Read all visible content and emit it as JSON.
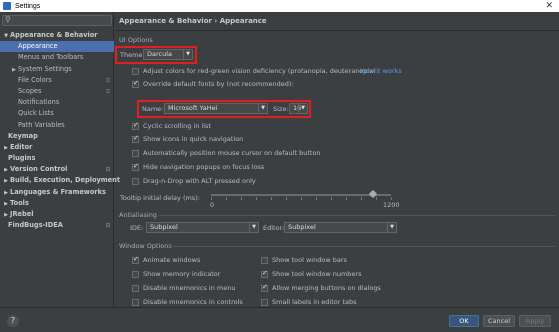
{
  "window": {
    "title": "Settings"
  },
  "search": {
    "placeholder": ""
  },
  "sidebar": {
    "items": [
      {
        "label": "Appearance & Behavior",
        "arrow": "▼",
        "bold": true
      },
      {
        "label": "Appearance",
        "selected": true
      },
      {
        "label": "Menus and Toolbars"
      },
      {
        "label": "System Settings",
        "arrow": "▶"
      },
      {
        "label": "File Colors",
        "gear": true
      },
      {
        "label": "Scopes",
        "gear": true
      },
      {
        "label": "Notifications"
      },
      {
        "label": "Quick Lists"
      },
      {
        "label": "Path Variables"
      },
      {
        "label": "Keymap",
        "bold": true
      },
      {
        "label": "Editor",
        "arrow": "▶",
        "bold": true
      },
      {
        "label": "Plugins",
        "bold": true
      },
      {
        "label": "Version Control",
        "arrow": "▶",
        "bold": true,
        "gear": true
      },
      {
        "label": "Build, Execution, Deployment",
        "arrow": "▶",
        "bold": true
      },
      {
        "label": "Languages & Frameworks",
        "arrow": "▶",
        "bold": true
      },
      {
        "label": "Tools",
        "arrow": "▶",
        "bold": true
      },
      {
        "label": "JRebel",
        "arrow": "▶",
        "bold": true
      },
      {
        "label": "FindBugs-IDEA",
        "bold": true,
        "gear": true
      }
    ]
  },
  "breadcrumb": "Appearance & Behavior › Appearance",
  "ui_options": {
    "section": "UI Options",
    "theme_label": "Theme:",
    "theme_value": "Darcula",
    "adjust_colors": "Adjust colors for red-green vision deficiency (protanopia, deuteranopia)",
    "how_it_works": "How it works",
    "override_fonts": "Override default fonts by (not recommended):",
    "name_label": "Name:",
    "name_value": "Microsoft YaHei",
    "size_label": "Size:",
    "size_value": "16",
    "cyclic": "Cyclic scrolling in list",
    "show_icons": "Show icons in quick navigation",
    "auto_mouse": "Automatically position mouse cursor on default button",
    "hide_nav": "Hide navigation popups on focus loss",
    "drag_drop": "Drag-n-Drop with ALT pressed only",
    "tooltip_label": "Tooltip initial delay (ms):",
    "tooltip_min": "0",
    "tooltip_max": "1200",
    "tooltip_value_fraction": 0.9
  },
  "antialiasing": {
    "section": "Antialiasing",
    "ide_label": "IDE:",
    "ide_value": "Subpixel",
    "editor_label": "Editor:",
    "editor_value": "Subpixel"
  },
  "window_options": {
    "section": "Window Options",
    "animate": "Animate windows",
    "memory": "Show memory indicator",
    "mnemonics_menu": "Disable mnemonics in menu",
    "mnemonics_controls": "Disable mnemonics in controls",
    "tool_bars": "Show tool window bars",
    "tool_numbers": "Show tool window numbers",
    "merging": "Allow merging buttons on dialogs",
    "small_labels": "Small labels in editor tabs"
  },
  "footer": {
    "help": "?",
    "ok": "OK",
    "cancel": "Cancel",
    "apply": "Apply"
  }
}
